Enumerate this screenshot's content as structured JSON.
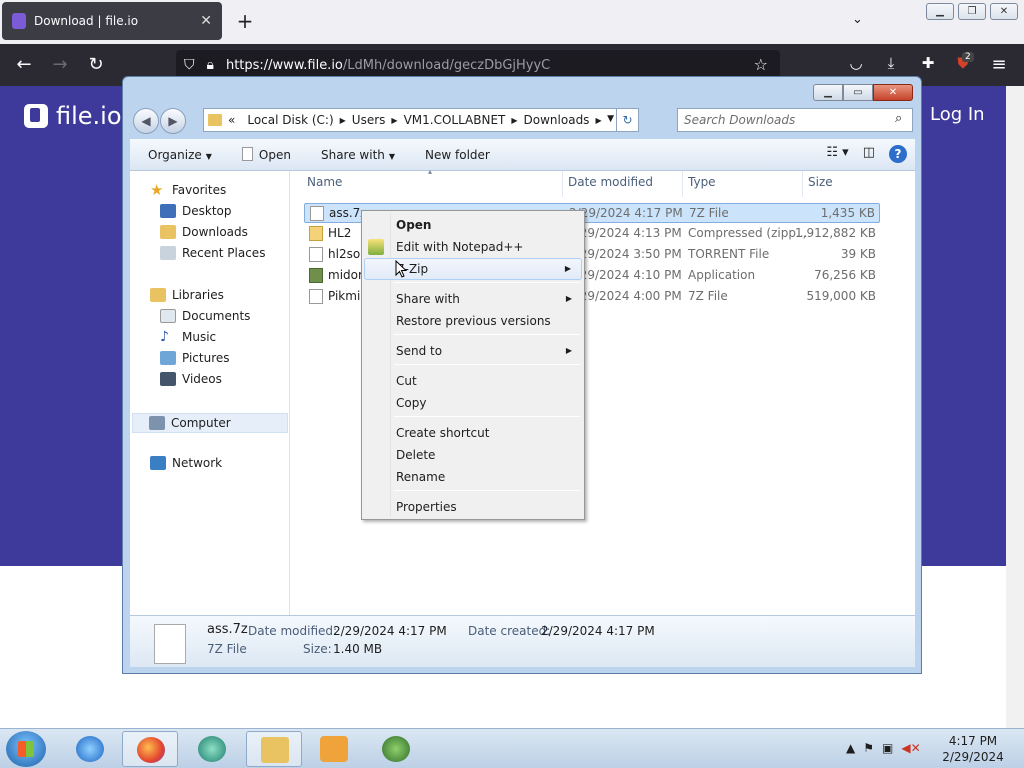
{
  "browser": {
    "tab_title": "Download | file.io",
    "tab_close": "✕",
    "new_tab": "+",
    "tab_list": "⌄",
    "url_host": "https://www.file.io",
    "url_path": "/LdMh/download/geczDbGjHyyC",
    "extension_badge": "2"
  },
  "page": {
    "brand": "file.io",
    "login": "Log In"
  },
  "explorer": {
    "breadcrumbs": [
      "«",
      "Local Disk (C:)",
      "Users",
      "VM1.COLLABNET",
      "Downloads"
    ],
    "search_placeholder": "Search Downloads",
    "toolbar": {
      "organize": "Organize",
      "open": "Open",
      "share_with": "Share with",
      "new_folder": "New folder"
    },
    "nav": {
      "favorites": "Favorites",
      "desktop": "Desktop",
      "downloads": "Downloads",
      "recent": "Recent Places",
      "libraries": "Libraries",
      "documents": "Documents",
      "music": "Music",
      "pictures": "Pictures",
      "videos": "Videos",
      "computer": "Computer",
      "network": "Network"
    },
    "columns": {
      "name": "Name",
      "date": "Date modified",
      "type": "Type",
      "size": "Size"
    },
    "files": [
      {
        "name": "ass.7z",
        "date": "2/29/2024 4:17 PM",
        "type": "7Z File",
        "size": "1,435 KB"
      },
      {
        "name": "HL2",
        "date": "2/29/2024 4:13 PM",
        "type": "Compressed (zipp...",
        "size": "1,912,882 KB"
      },
      {
        "name": "hl2sou",
        "date": "2/29/2024 3:50 PM",
        "type": "TORRENT File",
        "size": "39 KB"
      },
      {
        "name": "midori",
        "date": "2/29/2024 4:10 PM",
        "type": "Application",
        "size": "76,256 KB"
      },
      {
        "name": "Pikmin",
        "date": "2/29/2024 4:00 PM",
        "type": "7Z File",
        "size": "519,000 KB"
      }
    ],
    "details": {
      "name": "ass.7z",
      "type": "7Z File",
      "date_modified_label": "Date modified:",
      "date_modified": "2/29/2024 4:17 PM",
      "date_created_label": "Date created:",
      "date_created": "2/29/2024 4:17 PM",
      "size_label": "Size:",
      "size": "1.40 MB"
    }
  },
  "context_menu": {
    "open": "Open",
    "edit_notepad": "Edit with Notepad++",
    "zip": "7-Zip",
    "share_with": "Share with",
    "restore": "Restore previous versions",
    "send_to": "Send to",
    "cut": "Cut",
    "copy": "Copy",
    "create_shortcut": "Create shortcut",
    "delete": "Delete",
    "rename": "Rename",
    "properties": "Properties"
  },
  "taskbar": {
    "time": "4:17 PM",
    "date": "2/29/2024"
  },
  "colors": {
    "page_header": "#3e3a9c",
    "selection": "#cce4fb",
    "firefox_toolbar": "#2b2a33"
  }
}
